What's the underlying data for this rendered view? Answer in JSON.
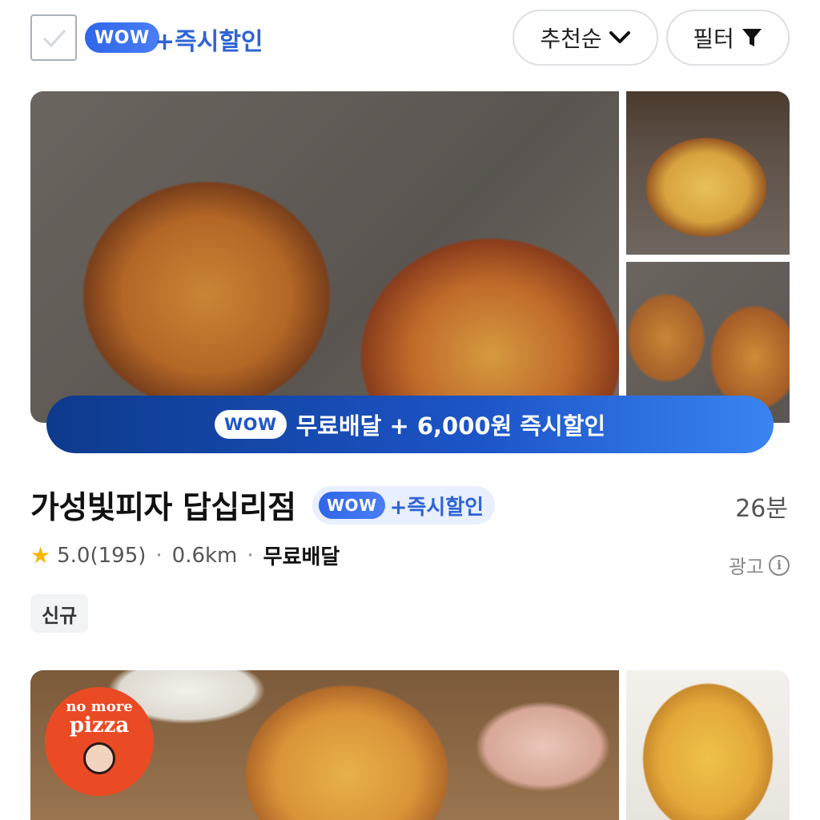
{
  "filter_bar": {
    "wow_badge": "WOW",
    "instant_discount_label": "+즉시할인",
    "sort_label": "추천순",
    "filter_label": "필터"
  },
  "stores": [
    {
      "banner": {
        "wow_badge": "WOW",
        "text": "무료배달 + 6,000원 즉시할인"
      },
      "name": "가성빛피자 답십리점",
      "badge": {
        "wow": "WOW",
        "text": "+즉시할인"
      },
      "eta": "26분",
      "rating": "5.0",
      "review_count": "(195)",
      "distance": "0.6km",
      "delivery": "무료배달",
      "ad_label": "광고",
      "tag": "신규"
    },
    {
      "logo_line1": "no more",
      "logo_line2": "pizza"
    }
  ],
  "colors": {
    "accent": "#2f63d6",
    "banner_start": "#0e3a8c",
    "banner_end": "#3a84f2",
    "star": "#f5b700"
  }
}
